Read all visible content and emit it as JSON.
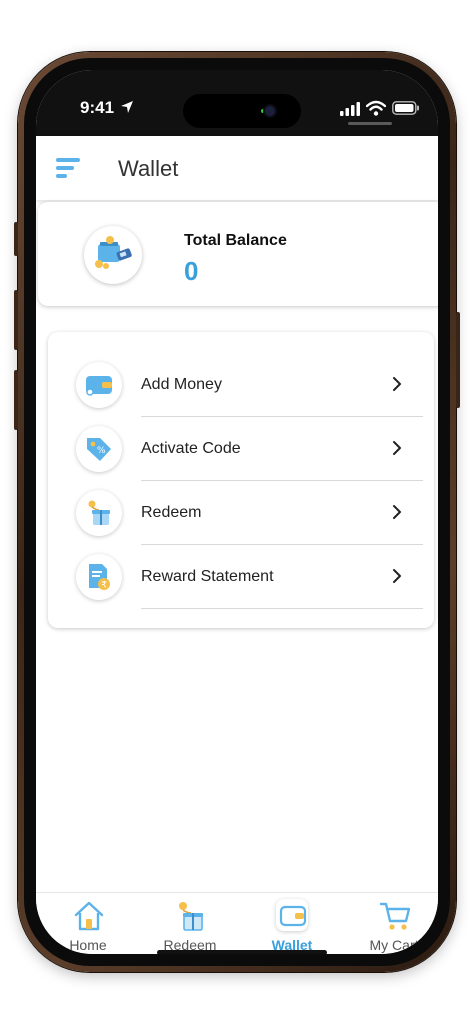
{
  "status_bar": {
    "time": "9:41"
  },
  "header": {
    "title": "Wallet"
  },
  "balance": {
    "label": "Total Balance",
    "value": "0"
  },
  "menu": [
    {
      "label": "Add Money",
      "icon": "wallet-icon"
    },
    {
      "label": "Activate Code",
      "icon": "tag-icon"
    },
    {
      "label": "Redeem",
      "icon": "gift-icon"
    },
    {
      "label": "Reward Statement",
      "icon": "statement-icon"
    }
  ],
  "bottom_nav": [
    {
      "label": "Home",
      "icon": "home-icon",
      "active": false
    },
    {
      "label": "Redeem",
      "icon": "gift-icon",
      "active": false
    },
    {
      "label": "Wallet",
      "icon": "wallet-icon",
      "active": true
    },
    {
      "label": "My Cart",
      "icon": "cart-icon",
      "active": false
    }
  ],
  "colors": {
    "accent": "#3aa0dc",
    "icon_blue": "#5bb3ea",
    "icon_yellow": "#f5c04a"
  }
}
